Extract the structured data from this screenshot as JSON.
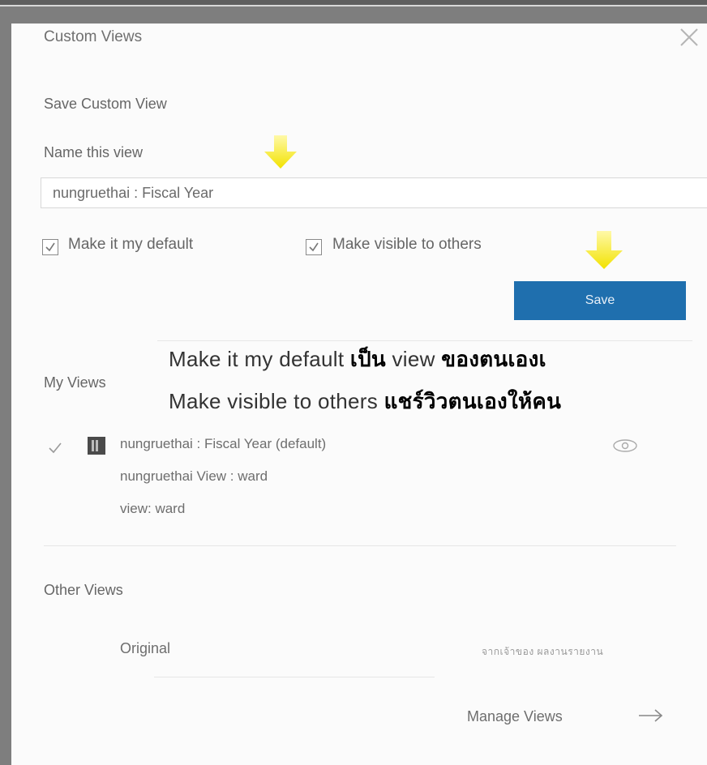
{
  "dialog": {
    "title": "Custom Views",
    "save_section": {
      "heading": "Save Custom View",
      "name_label": "Name this view",
      "name_value": "nungruethai : Fiscal Year",
      "checkbox_default": {
        "label": "Make it my default",
        "checked": true
      },
      "checkbox_visible": {
        "label": "Make visible to others",
        "checked": true
      },
      "save_label": "Save"
    },
    "my_views": {
      "heading": "My Views",
      "items": [
        {
          "label": "nungruethai : Fiscal Year (default)",
          "selected": true
        },
        {
          "label": "nungruethai View : ward"
        },
        {
          "label": "view: ward"
        }
      ]
    },
    "other_views": {
      "heading": "Other Views",
      "items": [
        {
          "label": "Original",
          "note": "จากเจ้าของ ผลงานรายงาน"
        }
      ]
    },
    "manage_label": "Manage Views"
  },
  "annotations": {
    "line1": {
      "prefix": "Make it my default ",
      "bold1": "เป็น",
      "mid": " view ",
      "bold2": "ของตนเองเ"
    },
    "line2": {
      "prefix": "Make visible to others ",
      "bold1": "แชร์วิวตนเองให้คน"
    }
  },
  "colors": {
    "accent": "#1f6fae",
    "highlight_arrow": "#f4e600"
  },
  "icons": {
    "close": "close-icon",
    "check": "check-icon",
    "dashboard": "dashboard-icon",
    "eye": "eye-icon",
    "arrow": "arrow-right-icon"
  }
}
